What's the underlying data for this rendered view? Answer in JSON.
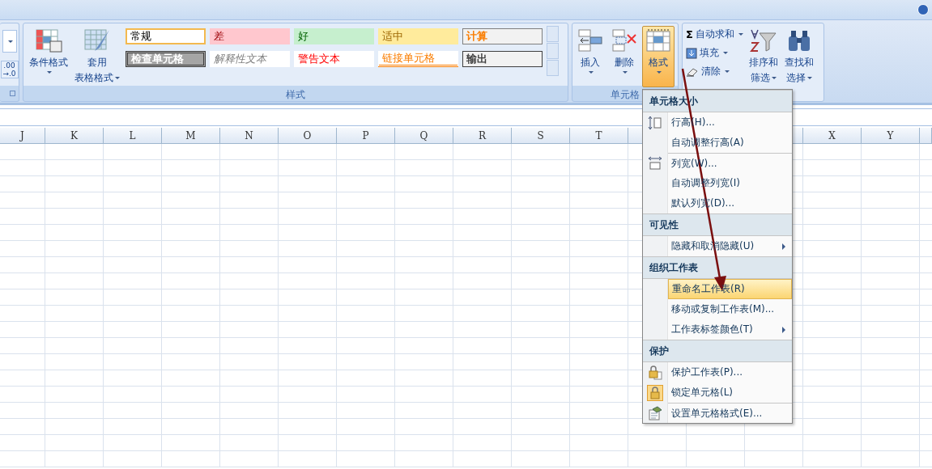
{
  "ribbon": {
    "left_group": {
      "number_button": [
        ".00",
        "→.0"
      ]
    },
    "styles_group": {
      "label": "样式",
      "buttons": [
        {
          "kind": "conditional",
          "lines": [
            "条件格式"
          ]
        },
        {
          "kind": "table",
          "lines": [
            "套用",
            "表格格式"
          ]
        }
      ],
      "gallery": [
        {
          "kind": "normal",
          "label": "常规",
          "selected": true
        },
        {
          "kind": "bad",
          "label": "差",
          "selected": false
        },
        {
          "kind": "good",
          "label": "好",
          "selected": false
        },
        {
          "kind": "neutral",
          "label": "适中",
          "selected": false
        },
        {
          "kind": "calculation",
          "label": "计算",
          "selected": false
        },
        {
          "kind": "check",
          "label": "检查单元格",
          "selected": false
        },
        {
          "kind": "explanatory",
          "label": "解释性文本",
          "selected": false
        },
        {
          "kind": "warning",
          "label": "警告文本",
          "selected": false
        },
        {
          "kind": "linked",
          "label": "链接单元格",
          "selected": false
        },
        {
          "kind": "output",
          "label": "输出",
          "selected": false
        }
      ]
    },
    "cells_group": {
      "label": "单元格",
      "buttons": [
        {
          "kind": "insert",
          "label": "插入",
          "selected": false
        },
        {
          "kind": "delete",
          "label": "删除",
          "selected": false
        },
        {
          "kind": "format",
          "label": "格式",
          "selected": true
        }
      ]
    },
    "editing_group": {
      "small_buttons": [
        {
          "kind": "sum",
          "icon_text": "Σ",
          "label": "自动求和"
        },
        {
          "kind": "fill",
          "label": "填充"
        },
        {
          "kind": "clear",
          "label": "清除"
        }
      ],
      "large_buttons": [
        {
          "kind": "sort",
          "lines": [
            "排序和",
            "筛选"
          ]
        },
        {
          "kind": "find",
          "lines": [
            "查找和",
            "选择"
          ]
        }
      ]
    }
  },
  "columns_left": [
    "J",
    "K",
    "L",
    "M",
    "N",
    "O",
    "P",
    "Q",
    "R",
    "S",
    "T"
  ],
  "columns_right": [
    "X",
    "Y"
  ],
  "menu": {
    "sections": [
      {
        "header": "单元格大小",
        "items": [
          {
            "kind": "row-height",
            "label": "行高(H)...",
            "submenu": false,
            "selected": false,
            "divider_before": false
          },
          {
            "kind": "plain",
            "label": "自动调整行高(A)",
            "submenu": false,
            "selected": false,
            "divider_before": false
          },
          {
            "kind": "column-width",
            "label": "列宽(W)...",
            "submenu": false,
            "selected": false,
            "divider_before": true
          },
          {
            "kind": "plain",
            "label": "自动调整列宽(I)",
            "submenu": false,
            "selected": false,
            "divider_before": false
          },
          {
            "kind": "plain",
            "label": "默认列宽(D)...",
            "submenu": false,
            "selected": false,
            "divider_before": false
          }
        ]
      },
      {
        "header": "可见性",
        "items": [
          {
            "kind": "plain",
            "label": "隐藏和取消隐藏(U)",
            "submenu": true,
            "selected": false,
            "divider_before": false
          }
        ]
      },
      {
        "header": "组织工作表",
        "items": [
          {
            "kind": "plain",
            "label": "重命名工作表(R)",
            "submenu": false,
            "selected": true,
            "divider_before": false
          },
          {
            "kind": "plain",
            "label": "移动或复制工作表(M)...",
            "submenu": false,
            "selected": false,
            "divider_before": false
          },
          {
            "kind": "plain",
            "label": "工作表标签颜色(T)",
            "submenu": true,
            "selected": false,
            "divider_before": false
          }
        ]
      },
      {
        "header": "保护",
        "items": [
          {
            "kind": "protect",
            "label": "保护工作表(P)...",
            "submenu": false,
            "selected": false,
            "divider_before": false
          },
          {
            "kind": "lock",
            "label": "锁定单元格(L)",
            "submenu": false,
            "selected": false,
            "divider_before": false
          },
          {
            "kind": "format-cells",
            "label": "设置单元格格式(E)...",
            "submenu": false,
            "selected": false,
            "divider_before": true
          }
        ]
      }
    ]
  }
}
